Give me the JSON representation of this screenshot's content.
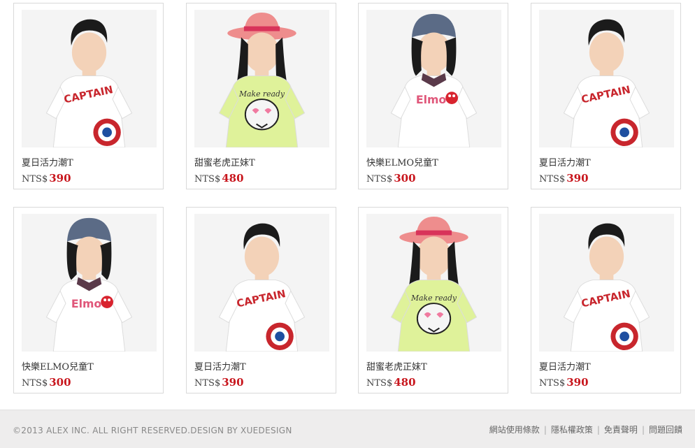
{
  "products": [
    {
      "name": "夏日活力潮T",
      "currency": "NTS$",
      "price": "390",
      "model": "young-man",
      "shirt": "#ffffff",
      "print": "captain"
    },
    {
      "name": "甜蜜老虎正妹T",
      "currency": "NTS$",
      "price": "480",
      "model": "young-woman",
      "shirt": "#dff29a",
      "print": "tiger"
    },
    {
      "name": "快樂ELMO兒童T",
      "currency": "NTS$",
      "price": "300",
      "model": "child",
      "shirt": "#ffffff",
      "print": "elmo"
    },
    {
      "name": "夏日活力潮T",
      "currency": "NTS$",
      "price": "390",
      "model": "young-man",
      "shirt": "#ffffff",
      "print": "captain"
    },
    {
      "name": "快樂ELMO兒童T",
      "currency": "NTS$",
      "price": "300",
      "model": "child",
      "shirt": "#ffffff",
      "print": "elmo"
    },
    {
      "name": "夏日活力潮T",
      "currency": "NTS$",
      "price": "390",
      "model": "young-man",
      "shirt": "#ffffff",
      "print": "captain"
    },
    {
      "name": "甜蜜老虎正妹T",
      "currency": "NTS$",
      "price": "480",
      "model": "young-woman",
      "shirt": "#dff29a",
      "print": "tiger"
    },
    {
      "name": "夏日活力潮T",
      "currency": "NTS$",
      "price": "390",
      "model": "young-man",
      "shirt": "#ffffff",
      "print": "captain"
    }
  ],
  "footer": {
    "copyright": "©2013 ALEX INC. ALL RIGHT RESERVED.DESIGN BY XUEDESIGN",
    "links": [
      "網站使用條款",
      "隱私權政策",
      "免責聲明",
      "問題回饋"
    ],
    "separator": "|"
  },
  "colors": {
    "price": "#c8161d",
    "card_border": "#d9d9d9",
    "footer_bg": "#eeeded"
  }
}
